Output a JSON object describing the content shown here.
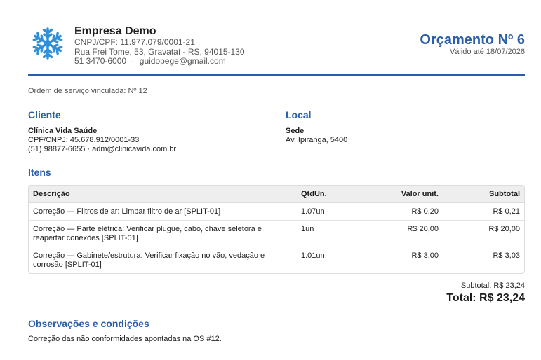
{
  "company": {
    "name": "Empresa Demo",
    "cnpj": "CNPJ/CPF: 11.977.079/0001-21",
    "address": "Rua Frei Tome, 53, Gravataí - RS, 94015-130",
    "phone": "51 3470-6000",
    "separator": "·",
    "email": "guidopege@gmail.com"
  },
  "quote": {
    "title": "Orçamento Nº 6",
    "valid_until": "Válido até 18/07/2026"
  },
  "service_order": "Ordem de serviço vinculada: Nº 12",
  "client": {
    "section_title": "Cliente",
    "name": "Clínica Vida Saúde",
    "document": "CPF/CNPJ: 45.678.912/0001-33",
    "contact": "(51) 98877-6655 · adm@clinicavida.com.br"
  },
  "location": {
    "section_title": "Local",
    "name": "Sede",
    "address": "Av. Ipiranga, 5400"
  },
  "items": {
    "section_title": "Itens",
    "headers": {
      "description": "Descrição",
      "qty_unit": "QtdUn.",
      "unit_value": "Valor unit.",
      "subtotal": "Subtotal"
    },
    "rows": [
      {
        "description": "Correção — Filtros de ar: Limpar filtro de ar [SPLIT-01]",
        "qty": "1.07un",
        "unit_value": "R$ 0,20",
        "subtotal": "R$ 0,21"
      },
      {
        "description": "Correção — Parte elétrica: Verificar plugue, cabo, chave seletora e reapertar conexões [SPLIT-01]",
        "qty": "1un",
        "unit_value": "R$ 20,00",
        "subtotal": "R$ 20,00"
      },
      {
        "description": "Correção — Gabinete/estrutura: Verificar fixação no vão, vedação e corrosão [SPLIT-01]",
        "qty": "1.01un",
        "unit_value": "R$ 3,00",
        "subtotal": "R$ 3,03"
      }
    ]
  },
  "totals": {
    "subtotal": "Subtotal: R$ 23,24",
    "total": "Total: R$ 23,24"
  },
  "observations": {
    "section_title": "Observações e condições",
    "text": "Correção das não conformidades apontadas na OS #12."
  },
  "colors": {
    "accent": "#2a5ea9",
    "logo": "#2f8fd8"
  }
}
